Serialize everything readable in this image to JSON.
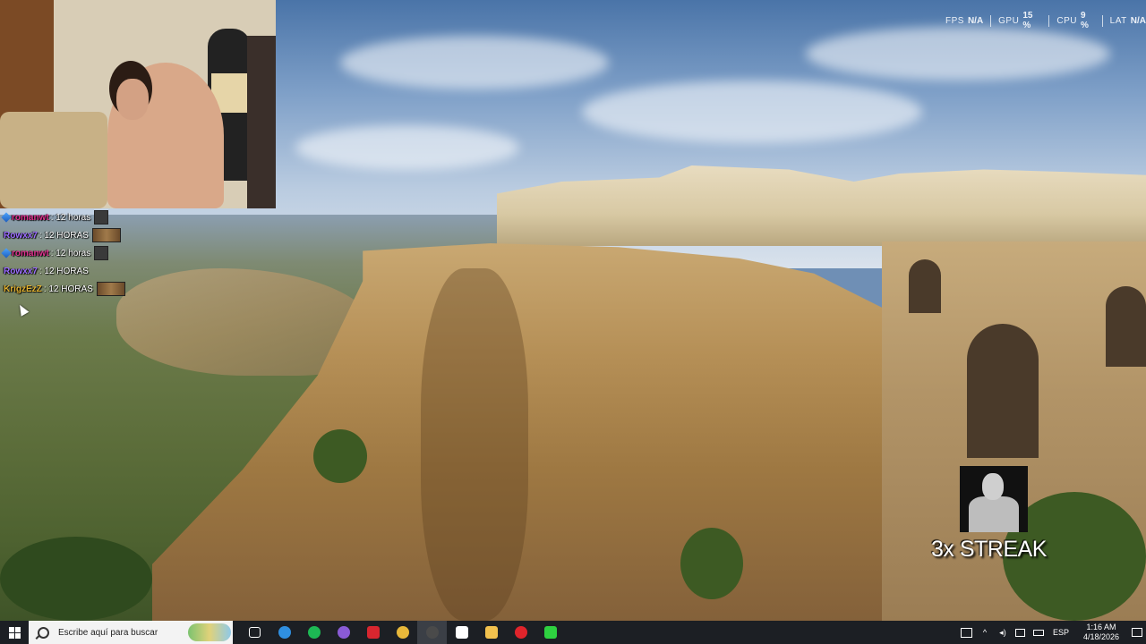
{
  "overlay": {
    "perf": [
      {
        "label": "FPS",
        "value": "N/A"
      },
      {
        "label": "GPU",
        "value": "15 %"
      },
      {
        "label": "CPU",
        "value": "9 %"
      },
      {
        "label": "LAT",
        "value": "N/A"
      }
    ],
    "streak": {
      "text": "3x STREAK"
    }
  },
  "chat": {
    "messages": [
      {
        "user": "romanwt",
        "user_color": "#e0318f",
        "text": ": 12 horas",
        "badge": true,
        "emote": "small"
      },
      {
        "user": "Rowxx7",
        "user_color": "#9a6bff",
        "text": ": 12 HORAS",
        "badge": false,
        "emote": "wide"
      },
      {
        "user": "romanwt",
        "user_color": "#e0318f",
        "text": ": 12 horas",
        "badge": true,
        "emote": "small"
      },
      {
        "user": "Rowxx7",
        "user_color": "#9a6bff",
        "text": ": 12 HORAS",
        "badge": false,
        "emote": ""
      },
      {
        "user": "KrigzEzZ",
        "user_color": "#e0b030",
        "text": ": 12 HORAS",
        "badge": false,
        "emote": "wide"
      }
    ]
  },
  "taskbar": {
    "search_placeholder": "Escribe aquí para buscar",
    "apps": [
      {
        "name": "task-view-icon",
        "color": "#ffffff"
      },
      {
        "name": "edge-icon",
        "color": "#2f8fe0"
      },
      {
        "name": "spotify-icon",
        "color": "#1db954"
      },
      {
        "name": "discord-icon",
        "color": "#8a5bd6"
      },
      {
        "name": "voicemod-icon",
        "color": "#d8262f"
      },
      {
        "name": "chrome-icon",
        "color": "#e8b83a"
      },
      {
        "name": "obs-icon",
        "color": "#4a4a4a"
      },
      {
        "name": "app-icon",
        "color": "#ffffff"
      },
      {
        "name": "file-explorer-icon",
        "color": "#f2c14e"
      },
      {
        "name": "opera-icon",
        "color": "#e0242b"
      },
      {
        "name": "kick-icon",
        "color": "#2ed140"
      }
    ],
    "language": "ESP",
    "time": "1:16 AM",
    "date": "4/18/2026"
  }
}
